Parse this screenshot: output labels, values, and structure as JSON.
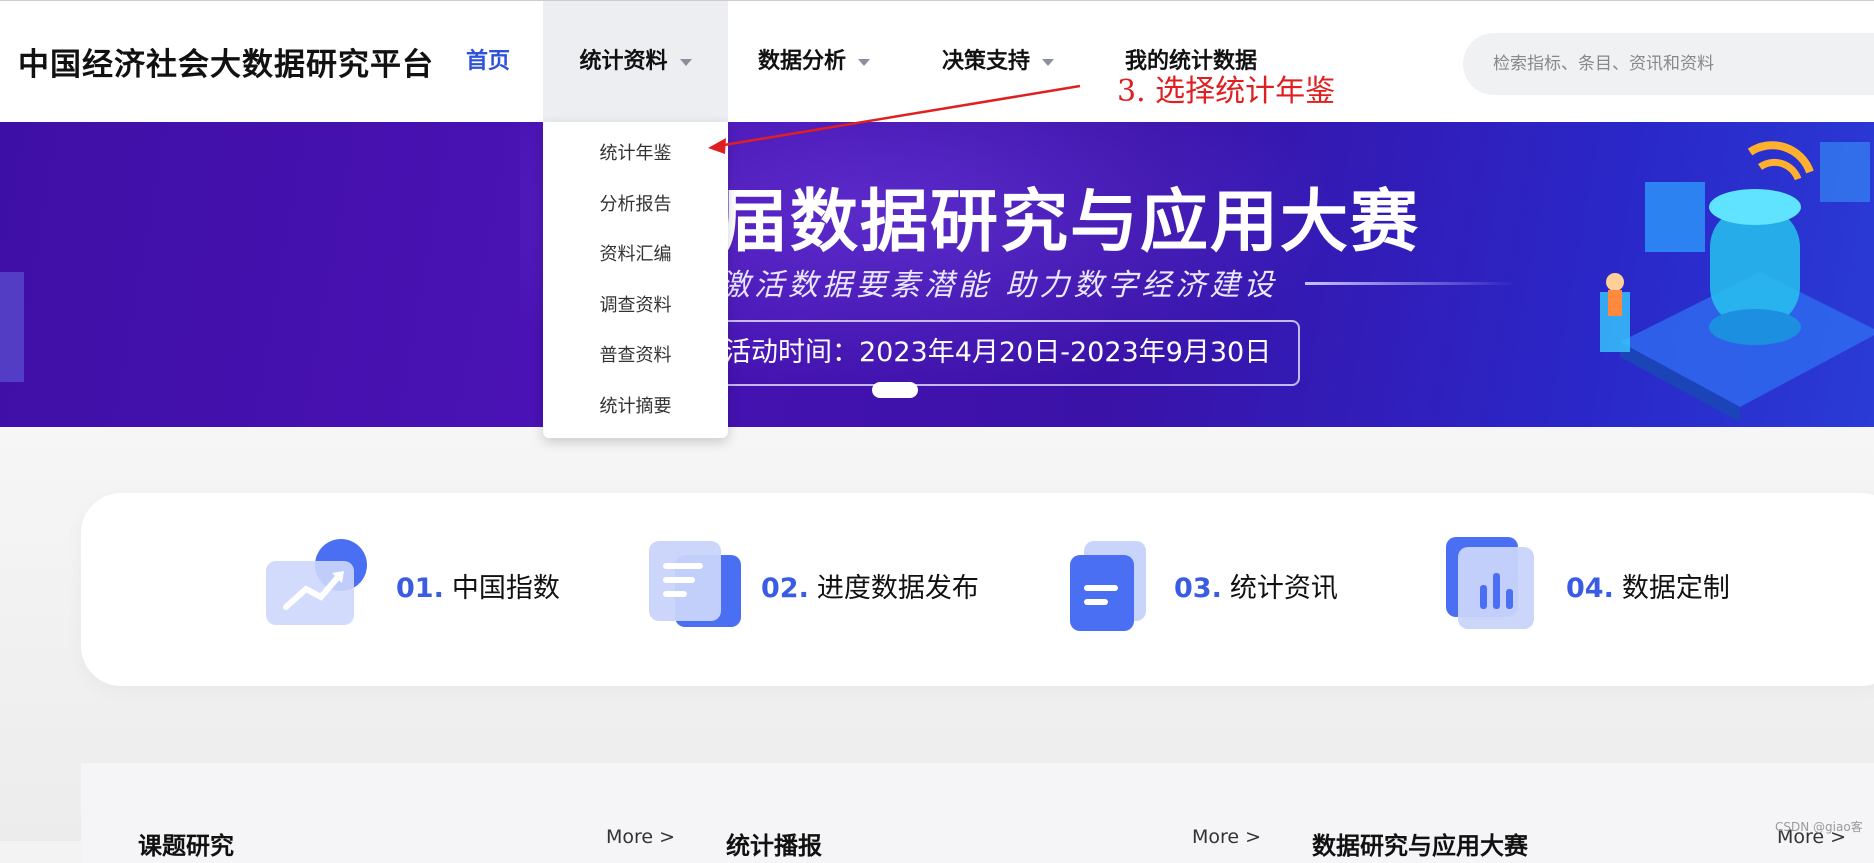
{
  "header": {
    "logo": "中国经济社会大数据研究平台",
    "nav": {
      "home": "首页",
      "stats": "统计资料",
      "analysis": "数据分析",
      "decision": "决策支持",
      "mine": "我的统计数据"
    },
    "search_placeholder": "检索指标、条目、资讯和资料"
  },
  "dropdown": {
    "items": [
      "统计年鉴",
      "分析报告",
      "资料汇编",
      "调查资料",
      "普查资料",
      "统计摘要"
    ]
  },
  "annotation": "3. 选择统计年鉴",
  "banner": {
    "title": "届数据研究与应用大赛",
    "subtitle": "激活数据要素潜能 助力数字经济建设",
    "time": "活动时间：2023年4月20日-2023年9月30日"
  },
  "quick_links": [
    {
      "num": "01.",
      "label": "中国指数"
    },
    {
      "num": "02.",
      "label": "进度数据发布"
    },
    {
      "num": "03.",
      "label": "统计资讯"
    },
    {
      "num": "04.",
      "label": "数据定制"
    }
  ],
  "lower": {
    "col1_title": "课题研究",
    "col2_title": "统计播报",
    "col3_title": "数据研究与应用大赛",
    "more": "More >"
  },
  "watermark": "CSDN @giao客",
  "colors": {
    "accent": "#3a5ce3",
    "annotation": "#e02020",
    "banner": "#4a12b4"
  }
}
